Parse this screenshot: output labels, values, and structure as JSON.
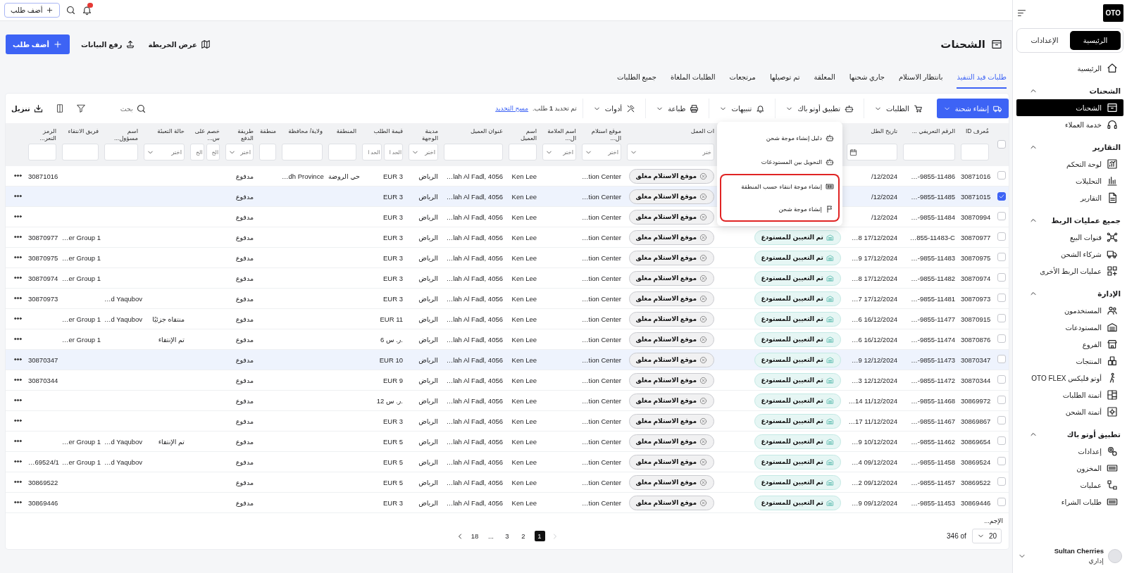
{
  "topbar": {
    "add_button": "أضف طلب",
    "notifications": {
      "unread": true
    }
  },
  "sidebar": {
    "logo": "OTO",
    "tabs": [
      {
        "label": "الرئيسية",
        "selected": true
      },
      {
        "label": "الإعدادات",
        "selected": false
      }
    ],
    "home": {
      "label": "الرئيسية",
      "selected": false
    },
    "sections": [
      {
        "title": "الشحنات",
        "expanded": true,
        "items": [
          {
            "label": "الشحنات",
            "selected": true
          },
          {
            "label": "خدمة العملاء",
            "selected": false
          }
        ]
      },
      {
        "title": "التقارير",
        "expanded": true,
        "items": [
          {
            "label": "لوحة التحكم",
            "selected": false
          },
          {
            "label": "التحليلات",
            "selected": false
          },
          {
            "label": "التقارير",
            "selected": false
          }
        ]
      },
      {
        "title": "جميع عمليات الربط",
        "expanded": true,
        "items": [
          {
            "label": "قنوات البيع",
            "selected": false
          },
          {
            "label": "شركاء الشحن",
            "selected": false
          },
          {
            "label": "عمليات الربط الأخرى",
            "selected": false
          }
        ]
      },
      {
        "title": "الإدارة",
        "expanded": true,
        "items": [
          {
            "label": "المستخدمون",
            "selected": false
          },
          {
            "label": "المستودعات",
            "selected": false
          },
          {
            "label": "الفروع",
            "selected": false
          },
          {
            "label": "المنتجات",
            "selected": false
          },
          {
            "label": "أوتو فليكس OTO FLEX",
            "selected": false
          },
          {
            "label": "أتمتة الطلبات",
            "selected": false
          },
          {
            "label": "أتمتة الشحن",
            "selected": false
          }
        ]
      },
      {
        "title": "تطبيق أوتو باك",
        "expanded": true,
        "items": [
          {
            "label": "إعدادات",
            "selected": false
          },
          {
            "label": "المخزون",
            "selected": false
          },
          {
            "label": "عمليات",
            "selected": false
          },
          {
            "label": "طلبات الشراء",
            "selected": false
          }
        ]
      }
    ],
    "user": {
      "name": "Sultan Cherries",
      "role": "إداري"
    }
  },
  "page": {
    "title": "الشحنات",
    "actions": [
      {
        "label": "عرض الخريطة",
        "kind": "plain"
      },
      {
        "label": "رفع البيانات",
        "kind": "plain"
      },
      {
        "label": "أضف طلب",
        "kind": "primary"
      }
    ]
  },
  "tabs": [
    {
      "label": "طلبات قيد التنفيذ",
      "selected": true
    },
    {
      "label": "بانتظار الاستلام",
      "selected": false
    },
    {
      "label": "جاري شحنها",
      "selected": false
    },
    {
      "label": "المعلقة",
      "selected": false
    },
    {
      "label": "تم توصيلها",
      "selected": false
    },
    {
      "label": "مرتجعات",
      "selected": false
    },
    {
      "label": "الطلبات الملغاة",
      "selected": false
    },
    {
      "label": "جميع الطلبات",
      "selected": false
    }
  ],
  "toolbar": {
    "buttons": [
      {
        "label": "إنشاء شحنة",
        "kind": "primary"
      },
      {
        "label": "الطلبات",
        "kind": "menu"
      },
      {
        "label": "تطبيق أوتو باك",
        "kind": "menu"
      },
      {
        "label": "تنبيهات",
        "kind": "menu"
      },
      {
        "label": "طباعة",
        "kind": "menu"
      },
      {
        "label": "أدوات",
        "kind": "menu"
      }
    ],
    "selection_note": "تم تحديد **1** طلب.",
    "clear_link": "مسح التحديد",
    "search": {
      "placeholder": "بحث"
    },
    "download": "تنزيل",
    "dropdown": [
      {
        "label": "دليل إنشاء موجة شحن",
        "highlighted": false
      },
      {
        "label": "التحويل بين المستودعات",
        "highlighted": false
      },
      {
        "label": "إنشاء موجة انتقاء حسب المنطقة",
        "highlighted": true
      },
      {
        "label": "إنشاء موجة شحن",
        "highlighted": true
      }
    ]
  },
  "table": {
    "select_all": false,
    "columns": [
      {
        "label": "مُعرف ID",
        "filter": {
          "kind": "text"
        }
      },
      {
        "label": "الرقم التعريفي ...",
        "filter": {
          "kind": "text"
        }
      },
      {
        "label": "تاريخ الطل",
        "filter": {
          "kind": "date"
        }
      },
      {
        "kind": "status"
      },
      {
        "label": "ات العمل",
        "kind": "tag",
        "filter": {
          "kind": "select",
          "placeholder": "ختر"
        }
      },
      {
        "label": "موقع استلام ال...",
        "filter": {
          "kind": "select",
          "placeholder": "اختر"
        }
      },
      {
        "label": "اسم العلامة ال...",
        "filter": {
          "kind": "select",
          "placeholder": "اختر"
        }
      },
      {
        "label": "اسم العميل",
        "filter": {
          "kind": "text"
        }
      },
      {
        "label": "عنوان العميل",
        "filter": {
          "kind": "text"
        }
      },
      {
        "label": "مدينة الوجهة",
        "filter": {
          "kind": "select",
          "placeholder": "اختر"
        }
      },
      {
        "label": "قيمة الطلب",
        "filter": {
          "kind": "range",
          "placeholders": [
            "الحد ا",
            "الحد ا"
          ]
        }
      },
      {
        "label": "المنطقة",
        "filter": {
          "kind": "text"
        }
      },
      {
        "label": "ولاية/ محافظة",
        "filter": {
          "kind": "text"
        }
      },
      {
        "label": "منطقة",
        "filter": {
          "kind": "text"
        }
      },
      {
        "label": "طريقة الدفع",
        "filter": {
          "kind": "select",
          "placeholder": "اختر"
        }
      },
      {
        "label": "خصم على س...",
        "filter": {
          "kind": "range",
          "placeholders": [
            "الح",
            "الح"
          ]
        }
      },
      {
        "label": "حالة التعبئة",
        "filter": {
          "kind": "select",
          "placeholder": "اختر"
        }
      },
      {
        "label": "اسم مسؤول...",
        "filter": {
          "kind": "text"
        }
      },
      {
        "label": "فريق الانتقاء",
        "filter": {
          "kind": "text"
        }
      },
      {
        "label": "الرمز التعر...",
        "filter": {
          "kind": "text"
        }
      },
      {
        "kind": "actions"
      }
    ],
    "rows": [
      {
        "selected": false,
        "hovered": false,
        "id": "30871016",
        "ref": "…-9855-11486",
        "date": "/12/2024",
        "work": "موقع الاستلام مغلق",
        "pickup": "…tion Center",
        "customer": "Ken Lee",
        "address": "…lah Al Fadl, 4056",
        "city": "الرياض",
        "value": "EUR 3",
        "region": "حي الروضة",
        "state": "…dh Province",
        "payment": "مدفوع",
        "code": "30871016"
      },
      {
        "selected": true,
        "hovered": false,
        "id": "30871015",
        "ref": "…-9855-11485",
        "date": "/12/2024",
        "work": "موقع الاستلام مغلق",
        "pickup": "…tion Center",
        "customer": "Ken Lee",
        "address": "…lah Al Fadl, 4056",
        "city": "الرياض",
        "value": "EUR 3",
        "payment": "مدفوع"
      },
      {
        "selected": false,
        "hovered": false,
        "id": "30870994",
        "ref": "…-9855-11484",
        "date": "/12/2024",
        "work": "موقع الاستلام مغلق",
        "pickup": "…tion Center",
        "customer": "Ken Lee",
        "address": "…lah Al Fadl, 4056",
        "city": "الرياض",
        "value": "EUR 3",
        "payment": "مدفوع"
      },
      {
        "selected": false,
        "hovered": false,
        "id": "30870977",
        "ref": "…855-11483-C",
        "date": "…8 17/12/2024",
        "status": "تم التعيين للمستودع",
        "work": "موقع الاستلام مغلق",
        "pickup": "…tion Center",
        "customer": "Ken Lee",
        "address": "…lah Al Fadl, 4056",
        "city": "الرياض",
        "value": "EUR 3",
        "payment": "مدفوع",
        "team": "…er Group 1",
        "code": "30870977"
      },
      {
        "selected": false,
        "hovered": false,
        "id": "30870975",
        "ref": "…-9855-11483",
        "date": "…9 17/12/2024",
        "status": "تم التعيين للمستودع",
        "work": "موقع الاستلام مغلق",
        "pickup": "…tion Center",
        "customer": "Ken Lee",
        "address": "…lah Al Fadl, 4056",
        "city": "الرياض",
        "value": "EUR 3",
        "payment": "مدفوع",
        "team": "…er Group 1",
        "code": "30870975"
      },
      {
        "selected": false,
        "hovered": false,
        "id": "30870974",
        "ref": "…-9855-11482",
        "date": "…8 17/12/2024",
        "status": "تم التعيين للمستودع",
        "work": "موقع الاستلام مغلق",
        "pickup": "…tion Center",
        "customer": "Ken Lee",
        "address": "…lah Al Fadl, 4056",
        "city": "الرياض",
        "value": "EUR 3",
        "payment": "مدفوع",
        "team": "…er Group 1",
        "code": "30870974"
      },
      {
        "selected": false,
        "hovered": false,
        "id": "30870973",
        "ref": "…-9855-11481",
        "date": "…7 17/12/2024",
        "status": "تم التعيين للمستودع",
        "work": "موقع الاستلام مغلق",
        "pickup": "…tion Center",
        "customer": "Ken Lee",
        "address": "…lah Al Fadl, 4056",
        "city": "الرياض",
        "value": "EUR 3",
        "payment": "مدفوع",
        "responsible": "…d Yaqubov",
        "code": "30870973"
      },
      {
        "selected": false,
        "hovered": false,
        "id": "30870915",
        "ref": "…-9855-11477",
        "date": "…6 16/12/2024",
        "status": "تم التعيين للمستودع",
        "work": "موقع الاستلام مغلق",
        "pickup": "…tion Center",
        "customer": "Ken Lee",
        "address": "…lah Al Fadl, 4056",
        "city": "الرياض",
        "value": "EUR 11",
        "payment": "مدفوع",
        "packing": "منتقاه جزئيًا",
        "responsible": "…d Yaqubov",
        "team": "…er Group 1"
      },
      {
        "selected": false,
        "hovered": false,
        "id": "30870876",
        "ref": "…-9855-11474",
        "date": "…6 16/12/2024",
        "status": "تم التعيين للمستودع",
        "work": "موقع الاستلام مغلق",
        "pickup": "…tion Center",
        "customer": "Ken Lee",
        "address": "…lah Al Fadl, 4056",
        "city": "الرياض",
        "value": "6 ر. س.",
        "payment": "مدفوع",
        "packing": "تم الإنتقاء",
        "team": "…er Group 1"
      },
      {
        "selected": false,
        "hovered": true,
        "id": "30870347",
        "ref": "…-9855-11473",
        "date": "…9 12/12/2024",
        "status": "تم التعيين للمستودع",
        "work": "موقع الاستلام مغلق",
        "pickup": "…tion Center",
        "customer": "Ken Lee",
        "address": "…lah Al Fadl, 4056",
        "city": "الرياض",
        "value": "EUR 10",
        "payment": "مدفوع",
        "code": "30870347"
      },
      {
        "selected": false,
        "hovered": false,
        "id": "30870344",
        "ref": "…-9855-11472",
        "date": "…3 12/12/2024",
        "status": "تم التعيين للمستودع",
        "work": "موقع الاستلام مغلق",
        "pickup": "…tion Center",
        "customer": "Ken Lee",
        "address": "…lah Al Fadl, 4056",
        "city": "الرياض",
        "value": "EUR 9",
        "payment": "مدفوع",
        "code": "30870344"
      },
      {
        "selected": false,
        "hovered": false,
        "id": "30869972",
        "ref": "…-9855-11468",
        "date": "…14 11/12/2024",
        "status": "تم التعيين للمستودع",
        "work": "موقع الاستلام مغلق",
        "pickup": "…tion Center",
        "customer": "Ken Lee",
        "address": "…lah Al Fadl, 4056",
        "city": "الرياض",
        "value": "12 ر. س.",
        "payment": "مدفوع"
      },
      {
        "selected": false,
        "hovered": false,
        "id": "30869867",
        "ref": "…-9855-11467",
        "date": "…17 11/12/2024",
        "status": "تم التعيين للمستودع",
        "work": "موقع الاستلام مغلق",
        "pickup": "…tion Center",
        "customer": "Ken Lee",
        "address": "…lah Al Fadl, 4056",
        "city": "الرياض",
        "value": "EUR 3",
        "payment": "مدفوع"
      },
      {
        "selected": false,
        "hovered": false,
        "id": "30869654",
        "ref": "…-9855-11462",
        "date": "…9 10/12/2024",
        "status": "تم التعيين للمستودع",
        "work": "موقع الاستلام مغلق",
        "pickup": "…tion Center",
        "customer": "Ken Lee",
        "address": "…lah Al Fadl, 4056",
        "city": "الرياض",
        "value": "EUR 5",
        "payment": "مدفوع",
        "packing": "تم الإنتقاء",
        "responsible": "…d Yaqubov",
        "team": "…er Group 1"
      },
      {
        "selected": false,
        "hovered": false,
        "id": "30869524",
        "ref": "…-9855-11458",
        "date": "…4 09/12/2024",
        "status": "تم التعيين للمستودع",
        "work": "موقع الاستلام مغلق",
        "pickup": "…tion Center",
        "customer": "Ken Lee",
        "address": "…lah Al Fadl, 4056",
        "city": "الرياض",
        "value": "EUR 5",
        "payment": "مدفوع",
        "responsible": "…d Yaqubov",
        "team": "…er Group 1",
        "code": "…69524/1"
      },
      {
        "selected": false,
        "hovered": false,
        "id": "30869522",
        "ref": "…-9855-11457",
        "date": "…2 09/12/2024",
        "status": "تم التعيين للمستودع",
        "work": "موقع الاستلام مغلق",
        "pickup": "…tion Center",
        "customer": "Ken Lee",
        "address": "…lah Al Fadl, 4056",
        "city": "الرياض",
        "value": "EUR 5",
        "payment": "مدفوع",
        "code": "30869522"
      },
      {
        "selected": false,
        "hovered": false,
        "id": "30869446",
        "ref": "…-9855-11453",
        "date": "…9 09/12/2024",
        "status": "تم التعيين للمستودع",
        "work": "موقع الاستلام مغلق",
        "pickup": "…tion Center",
        "customer": "Ken Lee",
        "address": "…lah Al Fadl, 4056",
        "city": "الرياض",
        "value": "EUR 3",
        "payment": "مدفوع",
        "code": "30869446"
      }
    ],
    "total_label": "الإجم..."
  },
  "pagination": {
    "page_size": "20",
    "count": "346 of",
    "prev": {
      "disabled": true
    },
    "next": {
      "disabled": false
    },
    "pages": [
      {
        "label": "1",
        "selected": true
      },
      {
        "label": "2",
        "selected": false
      },
      {
        "label": "3",
        "selected": false
      },
      {
        "label": "...",
        "selected": false
      },
      {
        "label": "18",
        "selected": false
      }
    ]
  }
}
